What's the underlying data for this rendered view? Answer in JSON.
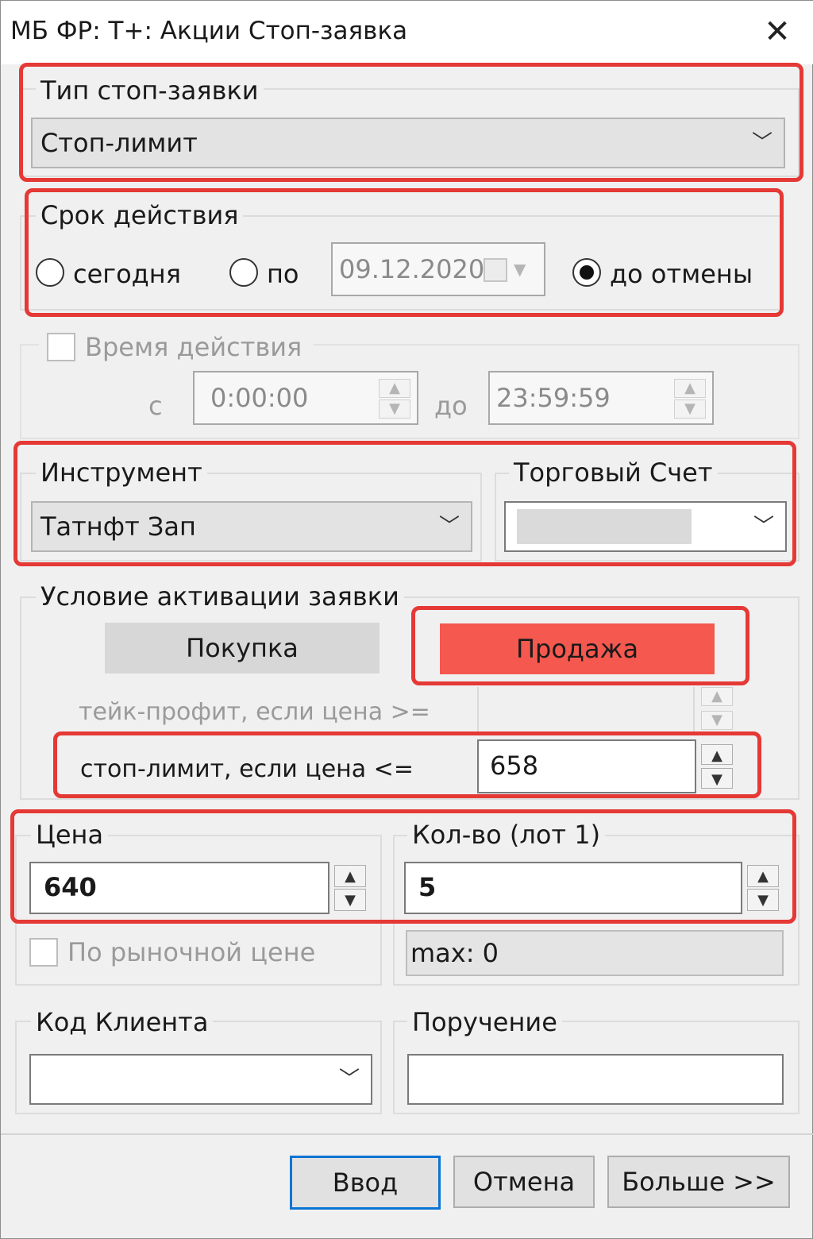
{
  "window": {
    "title": "МБ ФР: Т+: Акции Стоп-заявка"
  },
  "stop_type": {
    "legend": "Тип стоп-заявки",
    "value": "Стоп-лимит"
  },
  "validity": {
    "legend": "Срок действия",
    "today_label": "сегодня",
    "until_label": "по",
    "date_value": "09.12.2020",
    "gtc_label": "до отмены"
  },
  "time": {
    "label": "Время действия",
    "from_label": "с",
    "from_value": "0:00:00",
    "to_label": "до",
    "to_value": "23:59:59"
  },
  "instrument": {
    "legend": "Инструмент",
    "value": "Татнфт Зап"
  },
  "account": {
    "legend": "Торговый Счет",
    "value": ""
  },
  "activation": {
    "legend": "Условие активации заявки",
    "buy_label": "Покупка",
    "sell_label": "Продажа",
    "take_profit_label": "тейк-профит, если цена >=",
    "take_profit_value": "",
    "stop_limit_label": "стоп-лимит, если цена <=",
    "stop_limit_value": "658"
  },
  "price": {
    "legend": "Цена",
    "value": "640",
    "market_label": "По рыночной цене"
  },
  "qty": {
    "legend": "Кол-во (лот 1)",
    "value": "5",
    "max_text": "max: 0"
  },
  "client": {
    "legend": "Код Клиента",
    "value": ""
  },
  "instruction": {
    "legend": "Поручение",
    "value": ""
  },
  "buttons": {
    "enter": "Ввод",
    "cancel": "Отмена",
    "more": "Больше >>"
  },
  "colors": {
    "sell": "#f4584f",
    "highlight": "#e53935",
    "default_button": "#0a74d4"
  }
}
